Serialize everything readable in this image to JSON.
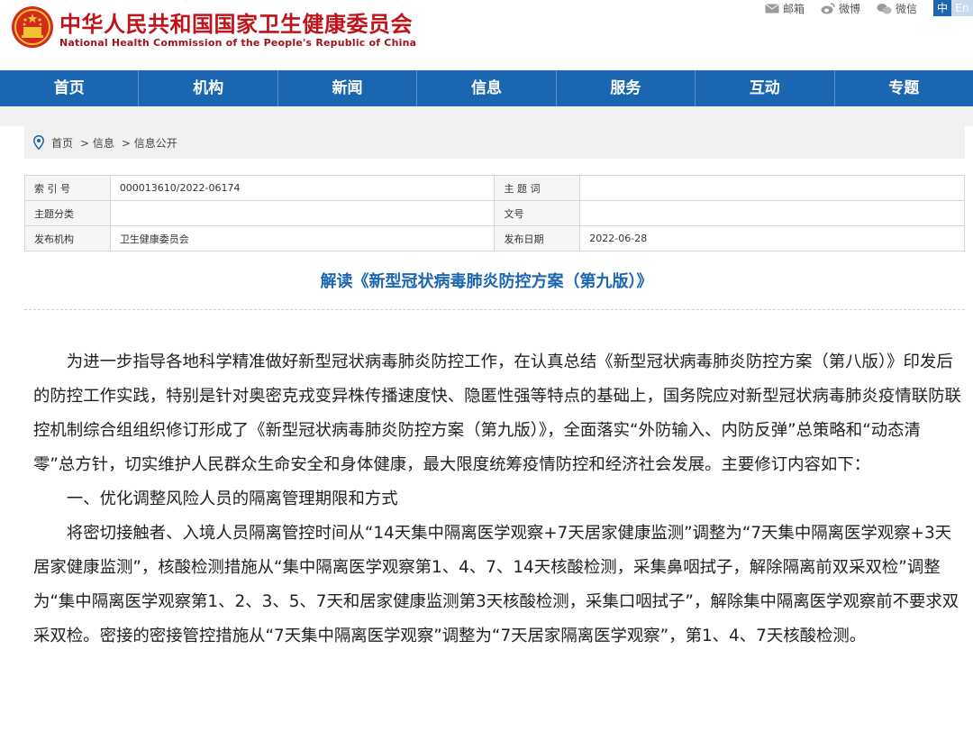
{
  "header": {
    "title_cn": "中华人民共和国国家卫生健康委员会",
    "title_en": "National Health Commission of the People's Republic of China",
    "links": [
      {
        "label": "邮箱",
        "icon": "mail-icon"
      },
      {
        "label": "微博",
        "icon": "weibo-icon"
      },
      {
        "label": "微信",
        "icon": "wechat-icon"
      }
    ],
    "lang_cn": "中",
    "lang_en": "En"
  },
  "nav": [
    "首页",
    "机构",
    "新闻",
    "信息",
    "服务",
    "互动",
    "专题"
  ],
  "breadcrumb": [
    "首页",
    "> 信息",
    "> 信息公开"
  ],
  "info": {
    "index_label": "索 引 号",
    "index_value": "000013610/2022-06174",
    "subject_label": "主 题 词",
    "subject_value": "",
    "category_label": "主题分类",
    "category_value": "",
    "docno_label": "文号",
    "docno_value": "",
    "publisher_label": "发布机构",
    "publisher_value": "卫生健康委员会",
    "date_label": "发布日期",
    "date_value": "2022-06-28"
  },
  "article": {
    "title": "解读《新型冠状病毒肺炎防控方案（第九版）》",
    "paragraphs": [
      "为进一步指导各地科学精准做好新型冠状病毒肺炎防控工作，在认真总结《新型冠状病毒肺炎防控方案（第八版）》印发后的防控工作实践，特别是针对奥密克戎变异株传播速度快、隐匿性强等特点的基础上，国务院应对新型冠状病毒肺炎疫情联防联控机制综合组组织修订形成了《新型冠状病毒肺炎防控方案（第九版）》，全面落实“外防输入、内防反弹”总策略和“动态清零”总方针，切实维护人民群众生命安全和身体健康，最大限度统筹疫情防控和经济社会发展。主要修订内容如下：",
      "一、优化调整风险人员的隔离管理期限和方式",
      "将密切接触者、入境人员隔离管控时间从“14天集中隔离医学观察+7天居家健康监测”调整为“7天集中隔离医学观察+3天居家健康监测”，核酸检测措施从“集中隔离医学观察第1、4、7、14天核酸检测，采集鼻咽拭子，解除隔离前双采双检”调整为“集中隔离医学观察第1、2、3、5、7天和居家健康监测第3天核酸检测，采集口咽拭子”，解除集中隔离医学观察前不要求双采双检。密接的密接管控措施从“7天集中隔离医学观察”调整为“7天居家隔离医学观察”，第1、4、7天核酸检测。"
    ]
  },
  "colors": {
    "brand_red": "#c0141b",
    "nav_blue": "#1b66b1",
    "title_blue": "#1b66b1"
  }
}
